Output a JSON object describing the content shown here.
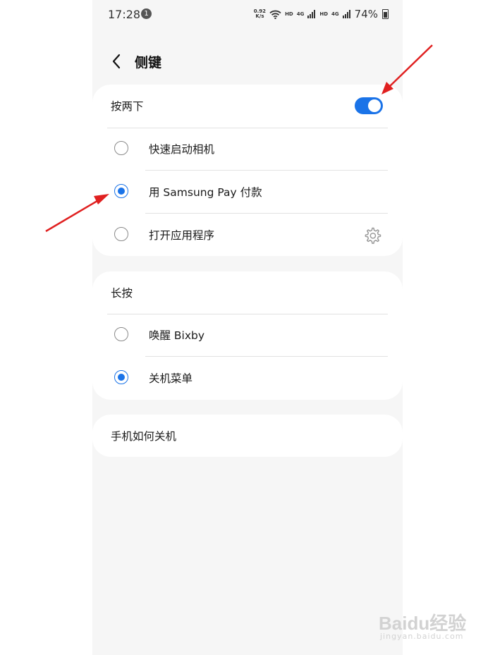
{
  "status_bar": {
    "time": "17:28",
    "notification_count": "1",
    "net_speed_value": "0.92",
    "net_speed_unit": "K/s",
    "hd1": "HD",
    "sig1": "4G",
    "hd2": "HD",
    "sig2": "4G",
    "battery": "74%"
  },
  "header": {
    "title": "侧键"
  },
  "double_press": {
    "label": "按两下",
    "toggle_on": true,
    "options": [
      {
        "label": "快速启动相机",
        "checked": false
      },
      {
        "label": "用 Samsung Pay 付款",
        "checked": true
      },
      {
        "label": "打开应用程序",
        "checked": false,
        "icon": "gear-icon"
      }
    ]
  },
  "long_press": {
    "label": "长按",
    "options": [
      {
        "label": "唤醒 Bixby",
        "checked": false
      },
      {
        "label": "关机菜单",
        "checked": true
      }
    ]
  },
  "power_off_help": {
    "label": "手机如何关机"
  },
  "watermark": {
    "text": "Baidu经验",
    "sub": "jingyan.baidu.com"
  },
  "colors": {
    "accent": "#1a73e8",
    "annotation_arrow": "#e02020",
    "background": "#f6f6f6"
  }
}
